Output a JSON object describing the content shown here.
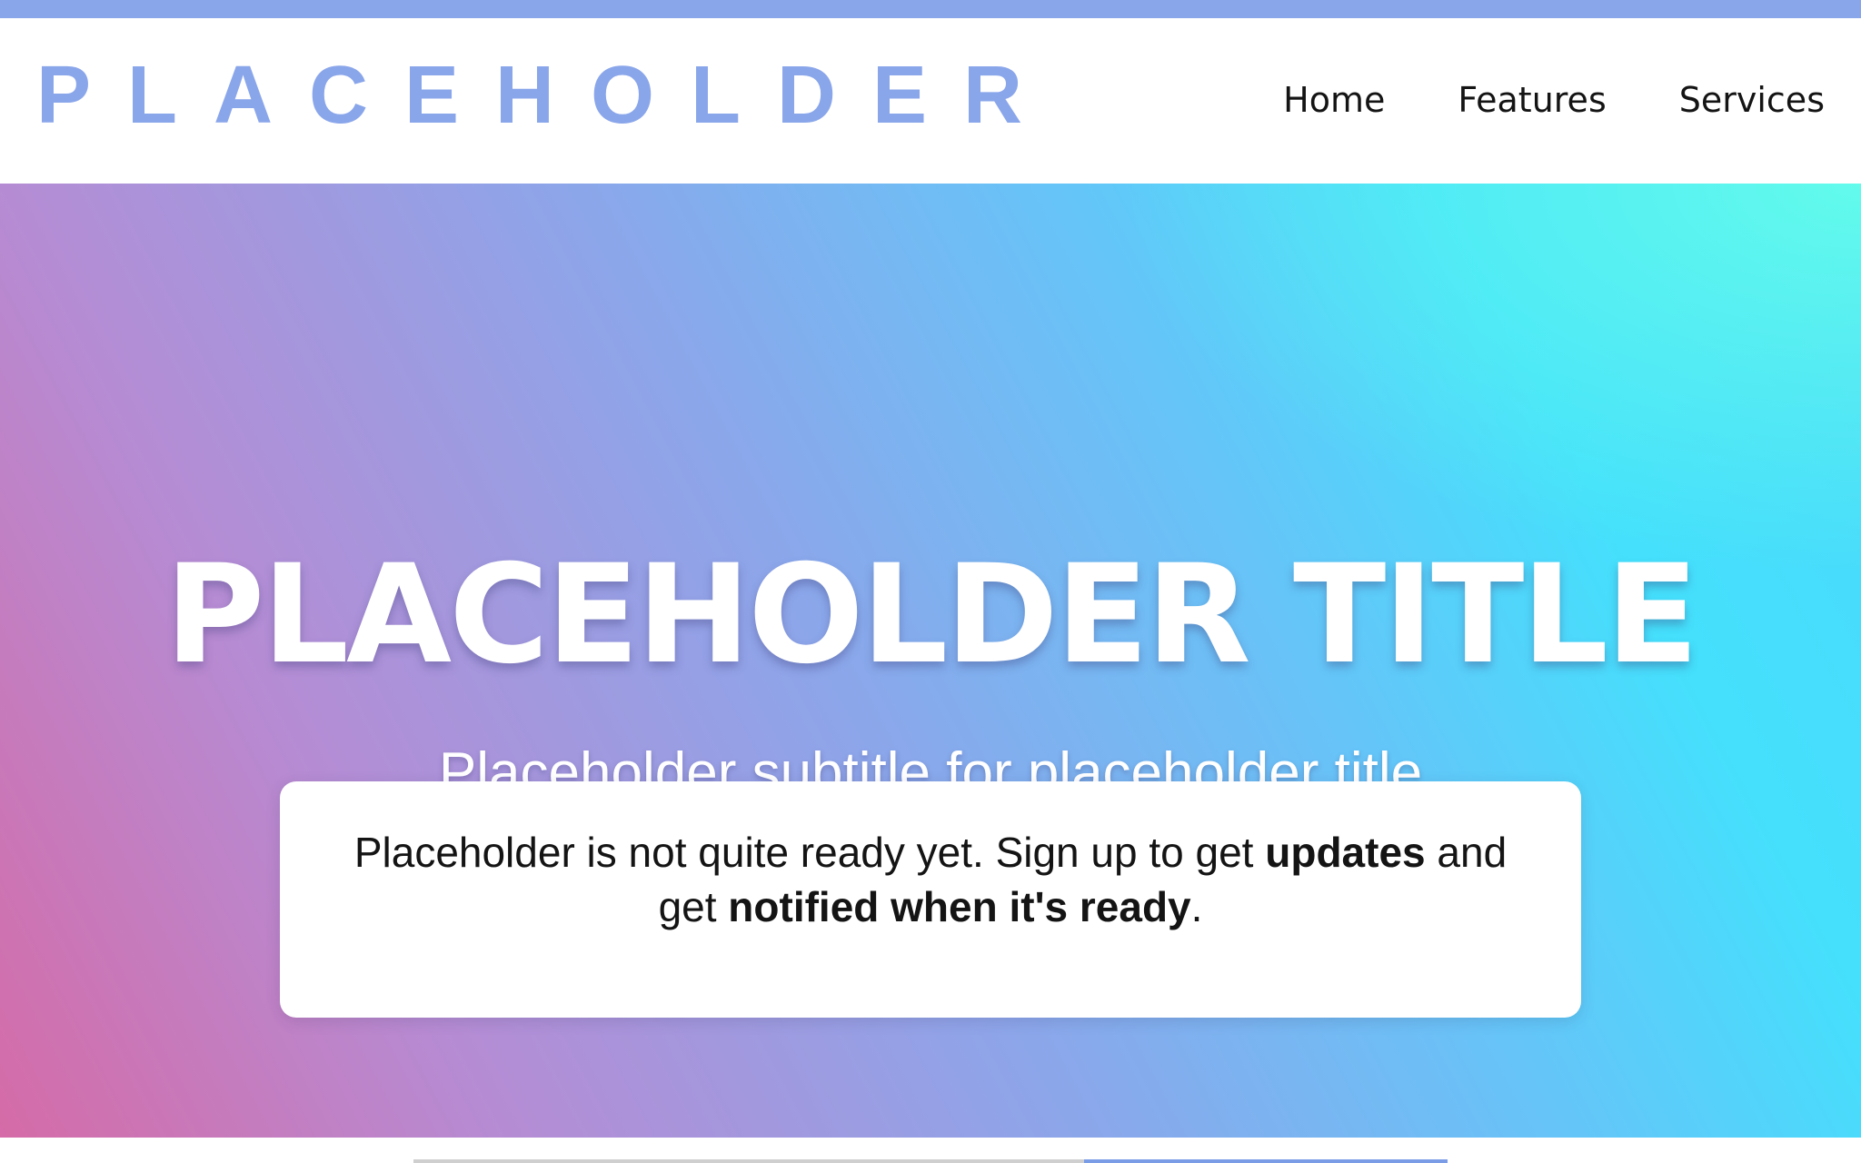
{
  "header": {
    "logo_text": "PLACEHOLDER",
    "nav": [
      {
        "label": "Home"
      },
      {
        "label": "Features"
      },
      {
        "label": "Services"
      }
    ]
  },
  "hero": {
    "title": "PLACEHOLDER TITLE",
    "subtitle": "Placeholder subtitle for placeholder title"
  },
  "signup": {
    "text_1": "Placeholder is not quite ready yet. Sign up to get ",
    "bold_1": "updates",
    "text_2": " and get ",
    "bold_2": "notified when it's ready",
    "text_3": "."
  },
  "colors": {
    "brand": "#8aa6ea",
    "accent_button": "#7a9be6"
  }
}
